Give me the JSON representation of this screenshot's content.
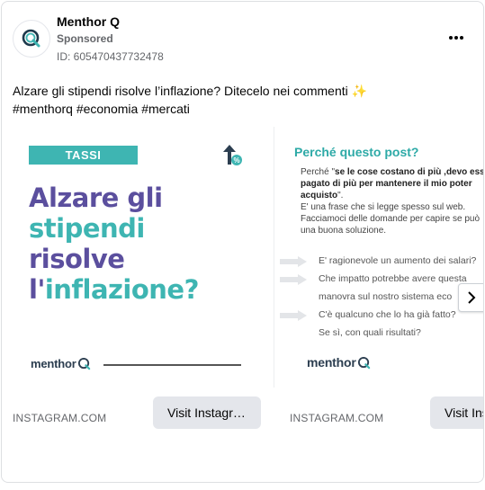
{
  "advertiser": {
    "name": "Menthor Q",
    "sponsored_label": "Sponsored",
    "ad_id": "ID: 605470437732478"
  },
  "caption": {
    "line1": "Alzare gli stipendi risolve l’inflazione? Ditecelo nei commenti ✨",
    "line2": "#menthorq #economia #mercati"
  },
  "cards": [
    {
      "tag": "TASSI",
      "headline": {
        "line1": "Alzare gli",
        "line2": "stipendi",
        "line3": "risolve",
        "line4_prefix": "l'",
        "line4_teal": "inflazione?"
      },
      "logo_text": "menthor",
      "domain": "INSTAGRAM.COM",
      "cta": "Visit Instagr…"
    },
    {
      "title": "Perché questo post?",
      "body_lines": [
        {
          "pre": "Perché \"",
          "bold": "se le cose costano di più ,devo ess",
          "post": ""
        },
        {
          "pre": "",
          "bold": "pagato di più per mantenere il mio poter",
          "post": ""
        },
        {
          "pre": "",
          "bold": "acquisto",
          "post": "\"."
        },
        {
          "pre": "E' una frase che si legge spesso sul web.",
          "bold": "",
          "post": ""
        },
        {
          "pre": "Facciamoci delle domande per capire se può",
          "bold": "",
          "post": ""
        },
        {
          "pre": "una buona soluzione.",
          "bold": "",
          "post": ""
        }
      ],
      "questions": [
        "E' ragionevole un aumento dei salari?",
        "Che impatto potrebbe avere questa",
        "manovra sul nostro sistema eco",
        "C'è qualcuno che lo ha già fatto?",
        "Se sì, con quali risultati?"
      ],
      "question_has_arrow": [
        true,
        true,
        false,
        true,
        false
      ],
      "logo_text": "menthor",
      "domain": "INSTAGRAM.COM",
      "cta": "Visit Ins"
    }
  ],
  "colors": {
    "brand_teal": "#3eb5b2",
    "brand_purple": "#5b4f9e",
    "cta_bg": "#e4e6eb"
  },
  "icons": {
    "more": "more-options-icon",
    "next": "chevron-right-icon",
    "avatar": "menthorq-logo-icon"
  }
}
